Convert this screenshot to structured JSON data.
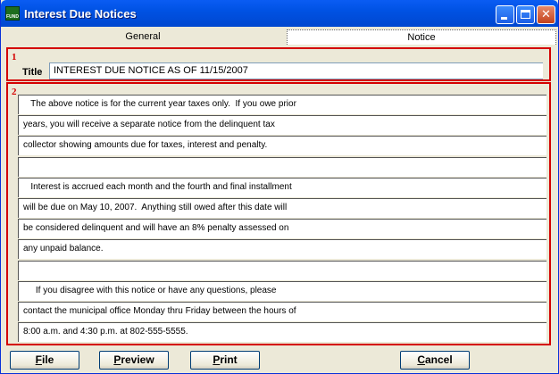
{
  "window": {
    "title": "Interest Due Notices",
    "app_icon_label": "FUND",
    "icon": "fund-app-icon"
  },
  "titlebar_buttons": {
    "minimize_icon": "minimize-icon",
    "maximize_icon": "maximize-icon",
    "close_glyph": "✕"
  },
  "tabs": [
    {
      "label": "General",
      "active": false
    },
    {
      "label": "Notice",
      "active": true
    }
  ],
  "section1": {
    "number": "1",
    "title_label": "Title",
    "title_value": "INTEREST DUE NOTICE AS OF 11/15/2007"
  },
  "section2": {
    "number": "2",
    "lines": [
      "   The above notice is for the current year taxes only.  If you owe prior",
      "years, you will receive a separate notice from the delinquent tax",
      "collector showing amounts due for taxes, interest and penalty.",
      "",
      "   Interest is accrued each month and the fourth and final installment",
      "will be due on May 10, 2007.  Anything still owed after this date will",
      "be considered delinquent and will have an 8% penalty assessed on",
      "any unpaid balance.",
      "",
      "     If you disagree with this notice or have any questions, please",
      "contact the municipal office Monday thru Friday between the hours of",
      "8:00 a.m. and 4:30 p.m. at 802-555-5555."
    ]
  },
  "buttons": {
    "file": {
      "key": "F",
      "rest": "ile"
    },
    "preview": {
      "key": "P",
      "rest": "review"
    },
    "print": {
      "key": "P",
      "rest": "rint"
    },
    "cancel": {
      "key": "C",
      "rest": "ancel"
    }
  },
  "colors": {
    "titlebar": "#0052e3",
    "section_border": "#d40000",
    "window_bg": "#ece9d8"
  }
}
